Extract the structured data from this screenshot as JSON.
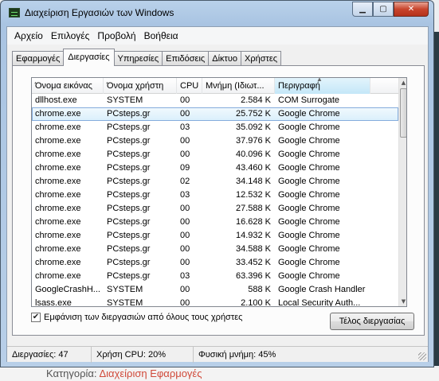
{
  "window": {
    "title": "Διαχείριση Εργασιών των Windows",
    "minimize_icon": "minimize-icon",
    "maximize_icon": "maximize-icon",
    "close_icon": "close-icon"
  },
  "menu": [
    "Αρχείο",
    "Επιλογές",
    "Προβολή",
    "Βοήθεια"
  ],
  "tabs": [
    {
      "label": "Εφαρμογές",
      "active": false
    },
    {
      "label": "Διεργασίες",
      "active": true
    },
    {
      "label": "Υπηρεσίες",
      "active": false
    },
    {
      "label": "Επιδόσεις",
      "active": false
    },
    {
      "label": "Δίκτυο",
      "active": false
    },
    {
      "label": "Χρήστες",
      "active": false
    }
  ],
  "table": {
    "columns": [
      "Όνομα εικόνας",
      "Όνομα χρήστη",
      "CPU",
      "Μνήμη (Ιδιωτ...",
      "Περιγραφή"
    ],
    "sorted_column": "Περιγραφή",
    "rows": [
      {
        "image": "dllhost.exe",
        "user": "SYSTEM",
        "cpu": "00",
        "memory": "2.584 K",
        "desc": "COM Surrogate",
        "selected": false
      },
      {
        "image": "chrome.exe",
        "user": "PCsteps.gr",
        "cpu": "00",
        "memory": "25.752 K",
        "desc": "Google Chrome",
        "selected": true
      },
      {
        "image": "chrome.exe",
        "user": "PCsteps.gr",
        "cpu": "03",
        "memory": "35.092 K",
        "desc": "Google Chrome",
        "selected": false
      },
      {
        "image": "chrome.exe",
        "user": "PCsteps.gr",
        "cpu": "00",
        "memory": "37.976 K",
        "desc": "Google Chrome",
        "selected": false
      },
      {
        "image": "chrome.exe",
        "user": "PCsteps.gr",
        "cpu": "00",
        "memory": "40.096 K",
        "desc": "Google Chrome",
        "selected": false
      },
      {
        "image": "chrome.exe",
        "user": "PCsteps.gr",
        "cpu": "09",
        "memory": "43.460 K",
        "desc": "Google Chrome",
        "selected": false
      },
      {
        "image": "chrome.exe",
        "user": "PCsteps.gr",
        "cpu": "02",
        "memory": "34.148 K",
        "desc": "Google Chrome",
        "selected": false
      },
      {
        "image": "chrome.exe",
        "user": "PCsteps.gr",
        "cpu": "03",
        "memory": "12.532 K",
        "desc": "Google Chrome",
        "selected": false
      },
      {
        "image": "chrome.exe",
        "user": "PCsteps.gr",
        "cpu": "00",
        "memory": "27.588 K",
        "desc": "Google Chrome",
        "selected": false
      },
      {
        "image": "chrome.exe",
        "user": "PCsteps.gr",
        "cpu": "00",
        "memory": "16.628 K",
        "desc": "Google Chrome",
        "selected": false
      },
      {
        "image": "chrome.exe",
        "user": "PCsteps.gr",
        "cpu": "00",
        "memory": "14.932 K",
        "desc": "Google Chrome",
        "selected": false
      },
      {
        "image": "chrome.exe",
        "user": "PCsteps.gr",
        "cpu": "00",
        "memory": "34.588 K",
        "desc": "Google Chrome",
        "selected": false
      },
      {
        "image": "chrome.exe",
        "user": "PCsteps.gr",
        "cpu": "00",
        "memory": "33.452 K",
        "desc": "Google Chrome",
        "selected": false
      },
      {
        "image": "chrome.exe",
        "user": "PCsteps.gr",
        "cpu": "03",
        "memory": "63.396 K",
        "desc": "Google Chrome",
        "selected": false
      },
      {
        "image": "GoogleCrashH...",
        "user": "SYSTEM",
        "cpu": "00",
        "memory": "588 K",
        "desc": "Google Crash Handler",
        "selected": false
      },
      {
        "image": "lsass.exe",
        "user": "SYSTEM",
        "cpu": "00",
        "memory": "2.100 K",
        "desc": "Local Security Auth...",
        "selected": false
      }
    ]
  },
  "show_all_users": {
    "label": "Εμφάνιση των διεργασιών από όλους τους χρήστες",
    "checked": true
  },
  "end_process_button": "Τέλος διεργασίας",
  "status": {
    "processes": "Διεργασίες: 47",
    "cpu": "Χρήση CPU: 20%",
    "memory": "Φυσική μνήμη: 45%"
  },
  "background": {
    "category_label": "Κατηγορία:",
    "category_value": "Διαχείριση Εφαρμογές"
  }
}
